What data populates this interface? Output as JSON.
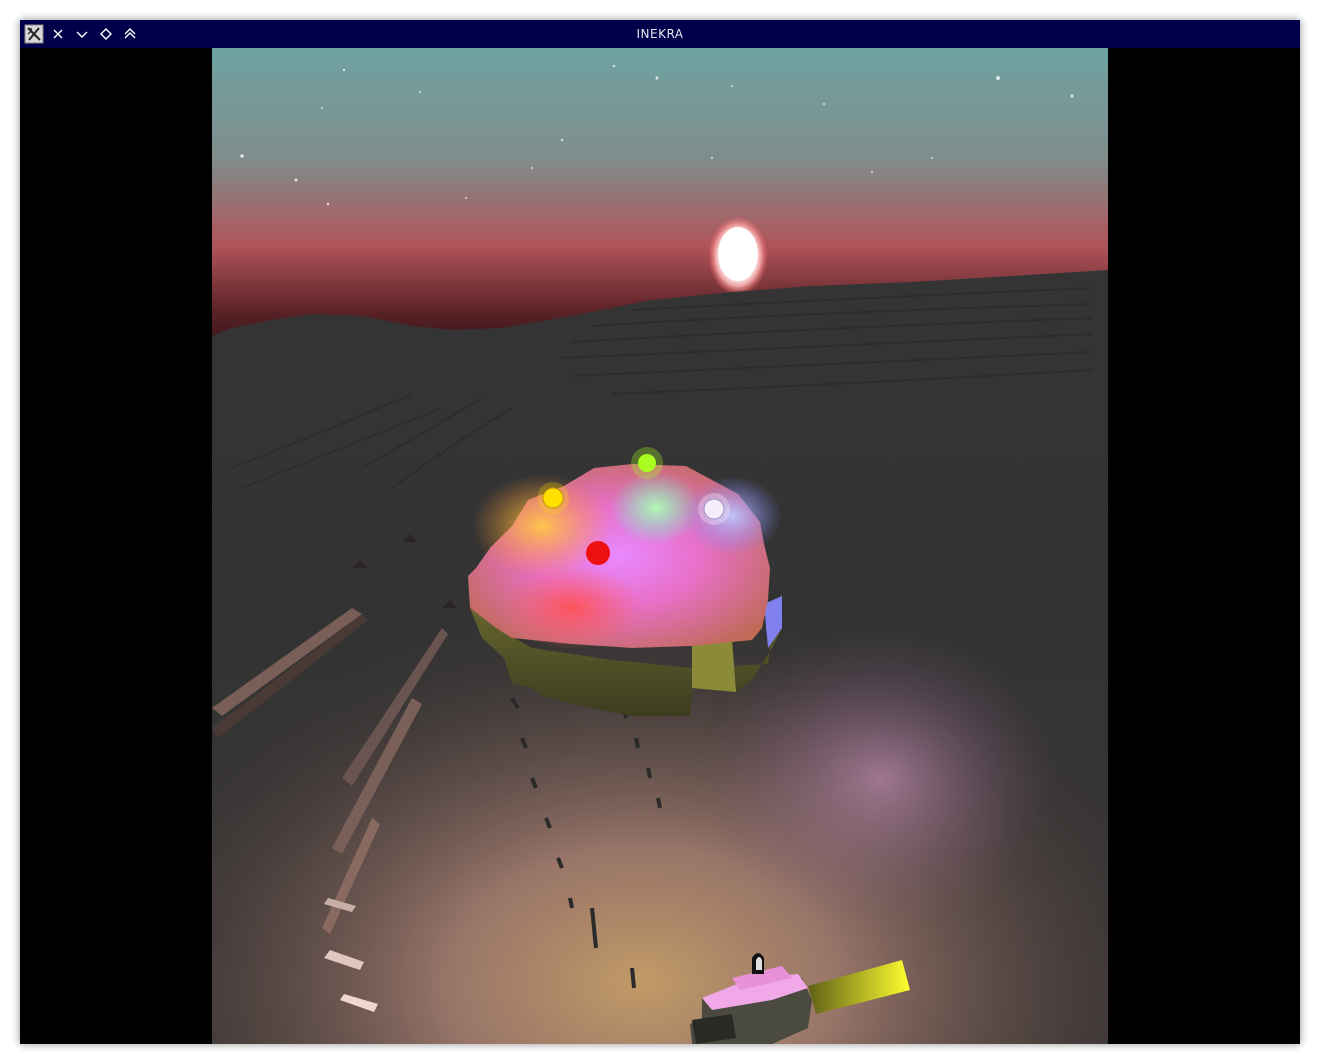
{
  "window": {
    "title": "INEKRA",
    "controls": [
      {
        "name": "app-menu-icon"
      },
      {
        "name": "close-icon"
      },
      {
        "name": "minimize-icon"
      },
      {
        "name": "maximize-icon"
      },
      {
        "name": "shade-icon"
      }
    ]
  },
  "scene": {
    "sky_colors": [
      "#6f9ea0",
      "#b0545a",
      "#1a0d10"
    ],
    "terrain_color": "#3a3a3a",
    "light_orbs": [
      {
        "name": "yellow-light-orb",
        "color": "#ffe000"
      },
      {
        "name": "green-light-orb",
        "color": "#a8ff20"
      },
      {
        "name": "white-light-orb",
        "color": "#f4eefc"
      },
      {
        "name": "red-light-orb",
        "color": "#ee1010"
      }
    ],
    "moon_color": "#ffffff"
  }
}
